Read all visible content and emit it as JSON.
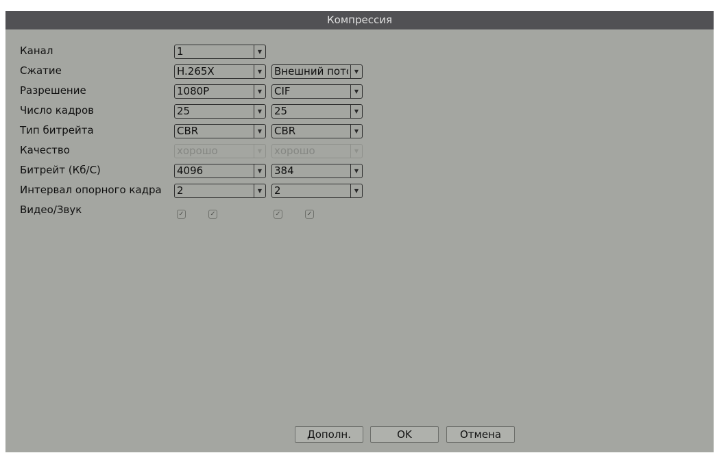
{
  "window": {
    "title": "Компрессия"
  },
  "labels": {
    "channel": "Канал",
    "compression": "Сжатие",
    "resolution": "Разрешение",
    "framerate": "Число кадров",
    "bitrate_type": "Тип битрейта",
    "quality": "Качество",
    "bitrate": "Битрейт (Кб/С)",
    "iframe_interval": "Интервал опорного кадра",
    "video_audio": "Видео/Звук"
  },
  "main_stream": {
    "channel": "1",
    "compression": "H.265X",
    "resolution": "1080P",
    "framerate": "25",
    "bitrate_type": "CBR",
    "quality": "хорошо",
    "bitrate": "4096",
    "iframe_interval": "2",
    "video_checked": true,
    "audio_checked": true
  },
  "extra_stream": {
    "stream_type": "Внешний поток",
    "resolution": "CIF",
    "framerate": "25",
    "bitrate_type": "CBR",
    "quality": "хорошо",
    "bitrate": "384",
    "iframe_interval": "2",
    "video_checked": true,
    "audio_checked": true
  },
  "icons": {
    "dropdown": "▼",
    "check": "✓"
  },
  "buttons": {
    "advanced": "Дополн.",
    "ok": "OK",
    "cancel": "Отмена"
  },
  "colors": {
    "panel": "#a4a6a1",
    "titlebar": "#515154"
  }
}
